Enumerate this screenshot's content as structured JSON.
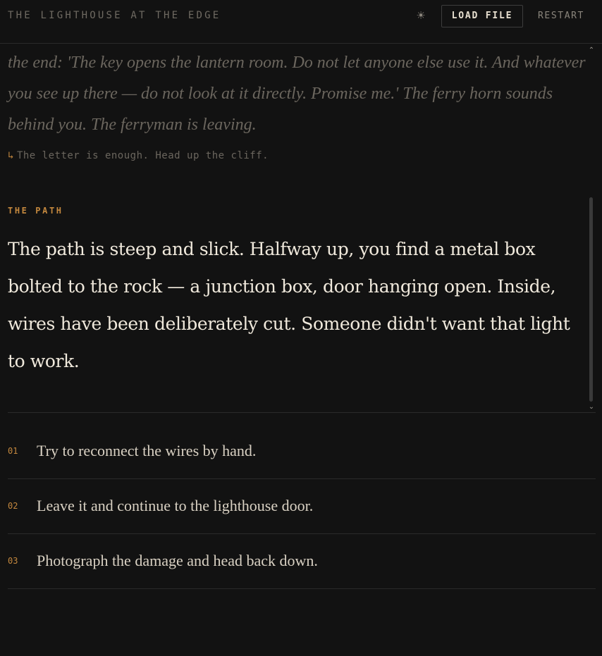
{
  "header": {
    "title": "THE LIGHTHOUSE AT THE EDGE",
    "theme_icon": "☀",
    "load_label": "LOAD FILE",
    "restart_label": "RESTART"
  },
  "history": {
    "passage": "the end: 'The key opens the lantern room. Do not let anyone else use it. And whatever you see up there — do not look at it directly. Promise me.' The ferry horn sounds behind you. The ferryman is leaving.",
    "choice_arrow": "↳",
    "choice": "The letter is enough. Head up the cliff."
  },
  "current": {
    "label": "THE PATH",
    "passage": "The path is steep and slick. Halfway up, you find a metal box bolted to the rock — a junction box, door hanging open. Inside, wires have been deliberately cut. Someone didn't want that light to work."
  },
  "scroll": {
    "up": "⌃",
    "down": "⌄"
  },
  "choices": [
    {
      "num": "01",
      "text": "Try to reconnect the wires by hand."
    },
    {
      "num": "02",
      "text": "Leave it and continue to the lighthouse door."
    },
    {
      "num": "03",
      "text": "Photograph the damage and head back down."
    }
  ],
  "colors": {
    "background": "#121212",
    "accent": "#c4883e",
    "text": "#f0e9dc",
    "muted": "#6b665e"
  }
}
